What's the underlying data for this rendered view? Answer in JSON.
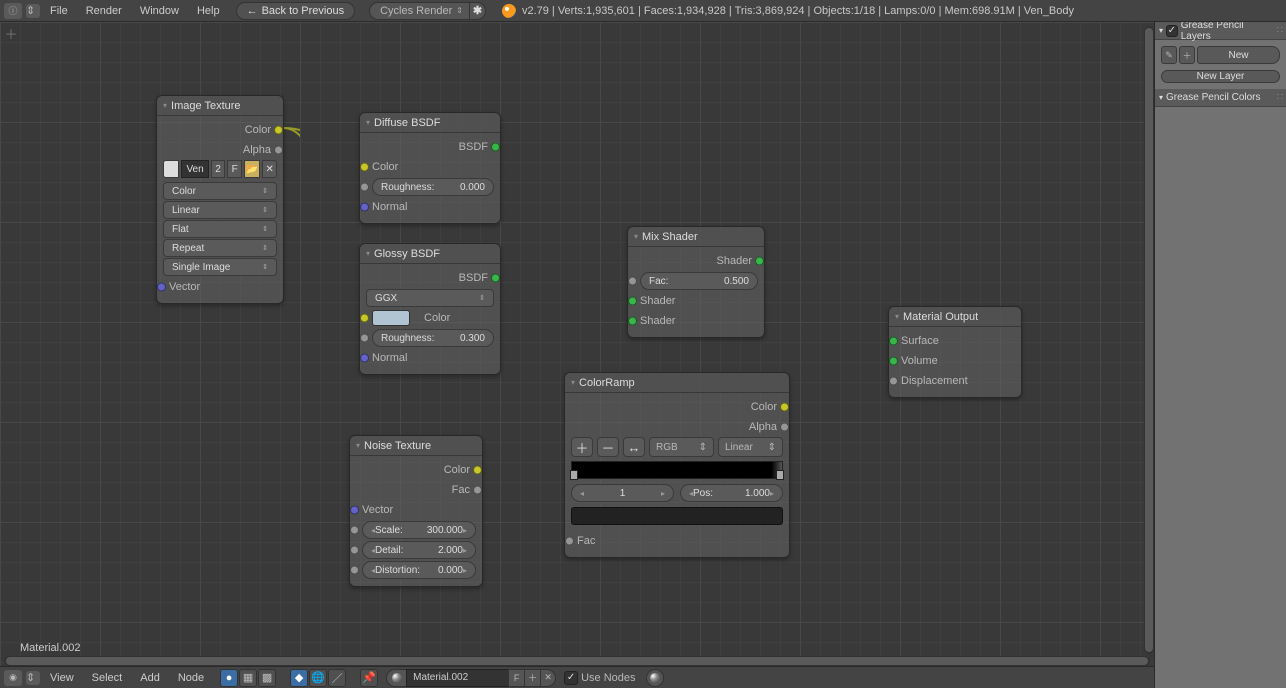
{
  "header": {
    "menus": [
      "File",
      "Render",
      "Window",
      "Help"
    ],
    "back_button": "Back to Previous",
    "render_engine": "Cycles Render",
    "stats": "v2.79 | Verts:1,935,601 | Faces:1,934,928 | Tris:3,869,924 | Objects:1/18 | Lamps:0/0 | Mem:698.91M | Ven_Body"
  },
  "right_panel": {
    "layers_header": "Grease Pencil Layers",
    "new_btn": "New",
    "new_layer_btn": "New Layer",
    "colors_header": "Grease Pencil Colors"
  },
  "bottom": {
    "menus": [
      "View",
      "Select",
      "Add",
      "Node"
    ],
    "material_name": "Material.002",
    "use_nodes_label": "Use Nodes"
  },
  "canvas": {
    "material_label": "Material.002"
  },
  "nodes": {
    "image_texture": {
      "title": "Image Texture",
      "out_color": "Color",
      "out_alpha": "Alpha",
      "image_name": "Ven",
      "image_users": "2",
      "fake_user": "F",
      "dd_colorspace": "Color",
      "dd_interp": "Linear",
      "dd_proj": "Flat",
      "dd_ext": "Repeat",
      "dd_src": "Single Image",
      "in_vector": "Vector"
    },
    "diffuse": {
      "title": "Diffuse BSDF",
      "out_bsdf": "BSDF",
      "in_color": "Color",
      "roughness_label": "Roughness:",
      "roughness_val": "0.000",
      "in_normal": "Normal"
    },
    "glossy": {
      "title": "Glossy BSDF",
      "out_bsdf": "BSDF",
      "dd_dist": "GGX",
      "in_color": "Color",
      "roughness_label": "Roughness:",
      "roughness_val": "0.300",
      "in_normal": "Normal"
    },
    "mix": {
      "title": "Mix Shader",
      "out_shader": "Shader",
      "fac_label": "Fac:",
      "fac_val": "0.500",
      "in_shader1": "Shader",
      "in_shader2": "Shader"
    },
    "material_output": {
      "title": "Material Output",
      "in_surface": "Surface",
      "in_volume": "Volume",
      "in_disp": "Displacement"
    },
    "noise": {
      "title": "Noise Texture",
      "out_color": "Color",
      "out_fac": "Fac",
      "in_vector": "Vector",
      "scale_label": "Scale:",
      "scale_val": "300.000",
      "detail_label": "Detail:",
      "detail_val": "2.000",
      "distortion_label": "Distortion:",
      "distortion_val": "0.000"
    },
    "ramp": {
      "title": "ColorRamp",
      "out_color": "Color",
      "out_alpha": "Alpha",
      "dd_mode": "RGB",
      "dd_interp": "Linear",
      "stop_idx": "1",
      "pos_label": "Pos:",
      "pos_val": "1.000",
      "in_fac": "Fac"
    }
  }
}
